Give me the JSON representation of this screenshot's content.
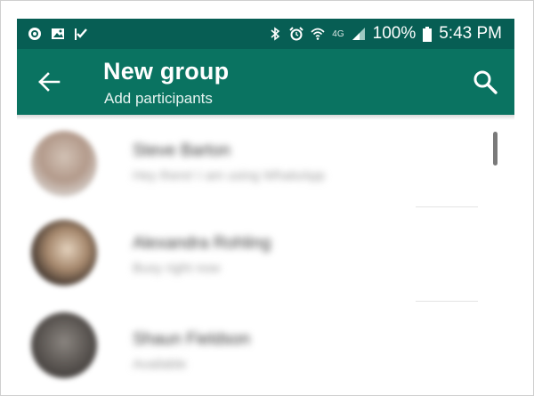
{
  "status_bar": {
    "network_label": "4G",
    "battery": "100%",
    "time": "5:43 PM",
    "icons": [
      "circle-notification-icon",
      "image-notification-icon",
      "check-flag-icon",
      "bluetooth-icon",
      "alarm-icon",
      "wifi-icon",
      "signal-icon",
      "battery-icon"
    ]
  },
  "app_bar": {
    "title": "New group",
    "subtitle": "Add participants",
    "icons": [
      "back-arrow-icon",
      "search-icon"
    ]
  },
  "contacts": [
    {
      "name": "Steve Barton",
      "status": "Hey there! I am using WhatsApp"
    },
    {
      "name": "Alexandra Rohling",
      "status": "Busy right now"
    },
    {
      "name": "Shaun Fieldson",
      "status": "Available"
    }
  ],
  "colors": {
    "status_bar": "#075e54",
    "app_bar": "#0a7361"
  }
}
